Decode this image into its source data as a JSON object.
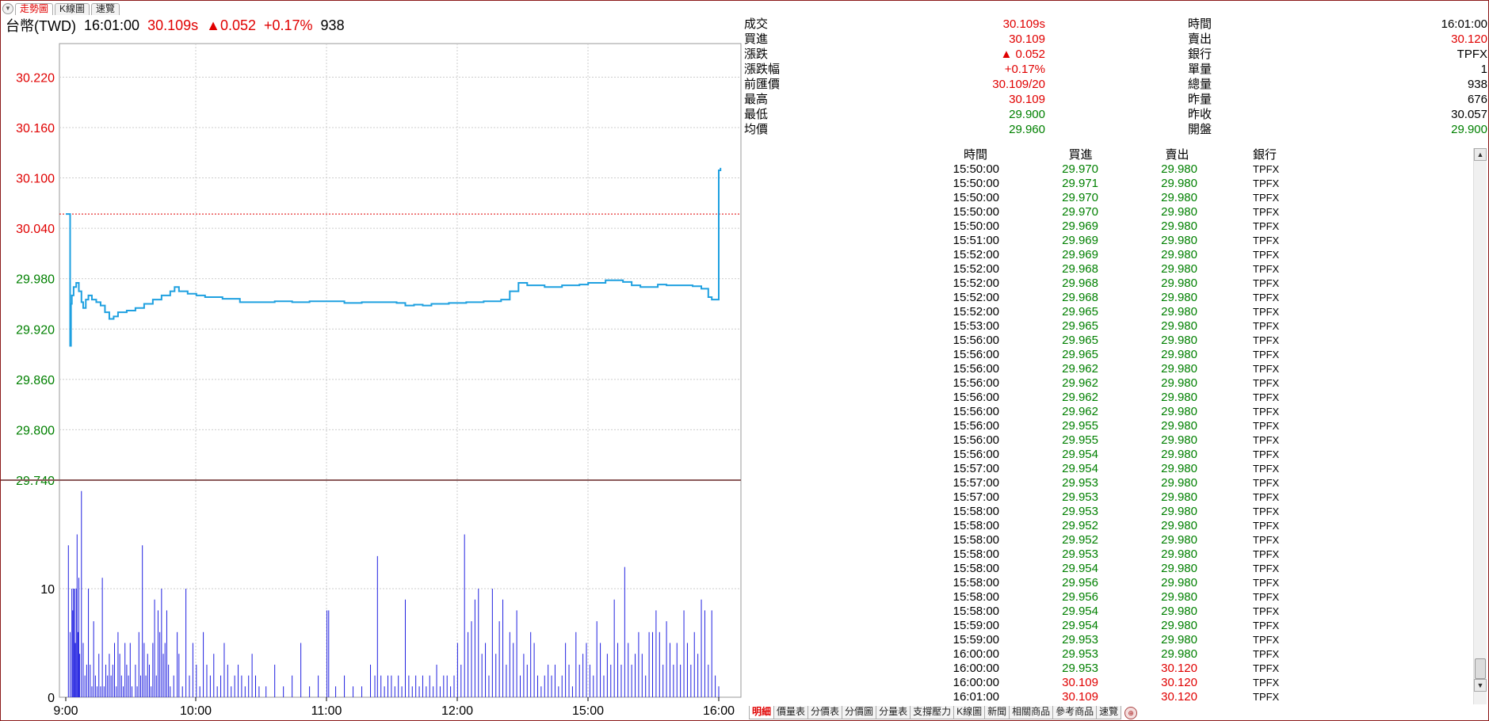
{
  "top_tabs": [
    "走勢圖",
    "K線圖",
    "速覽"
  ],
  "quote": {
    "symbol": "台幣(TWD)",
    "time": "16:01:00",
    "price": "30.109s",
    "change": "▲0.052",
    "change_pct": "+0.17%",
    "volume": "938"
  },
  "info_left": [
    {
      "label": "成交",
      "value": "30.109s",
      "color": "red"
    },
    {
      "label": "買進",
      "value": "30.109",
      "color": "red"
    },
    {
      "label": "漲跌",
      "value": "▲ 0.052",
      "color": "red"
    },
    {
      "label": "漲跌幅",
      "value": "+0.17%",
      "color": "red"
    },
    {
      "label": "前匯價",
      "value": "30.109/20",
      "color": "red"
    },
    {
      "label": "最高",
      "value": "30.109",
      "color": "red"
    },
    {
      "label": "最低",
      "value": "29.900",
      "color": "green"
    },
    {
      "label": "均價",
      "value": "29.960",
      "color": "green"
    }
  ],
  "info_right": [
    {
      "label": "時間",
      "value": "16:01:00",
      "color": "black"
    },
    {
      "label": "賣出",
      "value": "30.120",
      "color": "red"
    },
    {
      "label": "銀行",
      "value": "TPFX",
      "color": "black"
    },
    {
      "label": "單量",
      "value": "1",
      "color": "black"
    },
    {
      "label": "總量",
      "value": "938",
      "color": "black"
    },
    {
      "label": "昨量",
      "value": "676",
      "color": "black"
    },
    {
      "label": "昨收",
      "value": "30.057",
      "color": "black"
    },
    {
      "label": "開盤",
      "value": "29.900",
      "color": "green"
    }
  ],
  "trade_headers": {
    "time": "時間",
    "bid": "買進",
    "ask": "賣出",
    "bank": "銀行"
  },
  "trades": [
    {
      "time": "15:50:00",
      "bid": "29.970",
      "ask": "29.980",
      "bank": "TPFX",
      "up": false
    },
    {
      "time": "15:50:00",
      "bid": "29.971",
      "ask": "29.980",
      "bank": "TPFX",
      "up": false
    },
    {
      "time": "15:50:00",
      "bid": "29.970",
      "ask": "29.980",
      "bank": "TPFX",
      "up": false
    },
    {
      "time": "15:50:00",
      "bid": "29.970",
      "ask": "29.980",
      "bank": "TPFX",
      "up": false
    },
    {
      "time": "15:50:00",
      "bid": "29.969",
      "ask": "29.980",
      "bank": "TPFX",
      "up": false
    },
    {
      "time": "15:51:00",
      "bid": "29.969",
      "ask": "29.980",
      "bank": "TPFX",
      "up": false
    },
    {
      "time": "15:52:00",
      "bid": "29.969",
      "ask": "29.980",
      "bank": "TPFX",
      "up": false
    },
    {
      "time": "15:52:00",
      "bid": "29.968",
      "ask": "29.980",
      "bank": "TPFX",
      "up": false
    },
    {
      "time": "15:52:00",
      "bid": "29.968",
      "ask": "29.980",
      "bank": "TPFX",
      "up": false
    },
    {
      "time": "15:52:00",
      "bid": "29.968",
      "ask": "29.980",
      "bank": "TPFX",
      "up": false
    },
    {
      "time": "15:52:00",
      "bid": "29.965",
      "ask": "29.980",
      "bank": "TPFX",
      "up": false
    },
    {
      "time": "15:53:00",
      "bid": "29.965",
      "ask": "29.980",
      "bank": "TPFX",
      "up": false
    },
    {
      "time": "15:56:00",
      "bid": "29.965",
      "ask": "29.980",
      "bank": "TPFX",
      "up": false
    },
    {
      "time": "15:56:00",
      "bid": "29.965",
      "ask": "29.980",
      "bank": "TPFX",
      "up": false
    },
    {
      "time": "15:56:00",
      "bid": "29.962",
      "ask": "29.980",
      "bank": "TPFX",
      "up": false
    },
    {
      "time": "15:56:00",
      "bid": "29.962",
      "ask": "29.980",
      "bank": "TPFX",
      "up": false
    },
    {
      "time": "15:56:00",
      "bid": "29.962",
      "ask": "29.980",
      "bank": "TPFX",
      "up": false
    },
    {
      "time": "15:56:00",
      "bid": "29.962",
      "ask": "29.980",
      "bank": "TPFX",
      "up": false
    },
    {
      "time": "15:56:00",
      "bid": "29.955",
      "ask": "29.980",
      "bank": "TPFX",
      "up": false
    },
    {
      "time": "15:56:00",
      "bid": "29.955",
      "ask": "29.980",
      "bank": "TPFX",
      "up": false
    },
    {
      "time": "15:56:00",
      "bid": "29.954",
      "ask": "29.980",
      "bank": "TPFX",
      "up": false
    },
    {
      "time": "15:57:00",
      "bid": "29.954",
      "ask": "29.980",
      "bank": "TPFX",
      "up": false
    },
    {
      "time": "15:57:00",
      "bid": "29.953",
      "ask": "29.980",
      "bank": "TPFX",
      "up": false
    },
    {
      "time": "15:57:00",
      "bid": "29.953",
      "ask": "29.980",
      "bank": "TPFX",
      "up": false
    },
    {
      "time": "15:58:00",
      "bid": "29.953",
      "ask": "29.980",
      "bank": "TPFX",
      "up": false
    },
    {
      "time": "15:58:00",
      "bid": "29.952",
      "ask": "29.980",
      "bank": "TPFX",
      "up": false
    },
    {
      "time": "15:58:00",
      "bid": "29.952",
      "ask": "29.980",
      "bank": "TPFX",
      "up": false
    },
    {
      "time": "15:58:00",
      "bid": "29.953",
      "ask": "29.980",
      "bank": "TPFX",
      "up": false
    },
    {
      "time": "15:58:00",
      "bid": "29.954",
      "ask": "29.980",
      "bank": "TPFX",
      "up": false
    },
    {
      "time": "15:58:00",
      "bid": "29.956",
      "ask": "29.980",
      "bank": "TPFX",
      "up": false
    },
    {
      "time": "15:58:00",
      "bid": "29.956",
      "ask": "29.980",
      "bank": "TPFX",
      "up": false
    },
    {
      "time": "15:58:00",
      "bid": "29.954",
      "ask": "29.980",
      "bank": "TPFX",
      "up": false
    },
    {
      "time": "15:59:00",
      "bid": "29.954",
      "ask": "29.980",
      "bank": "TPFX",
      "up": false
    },
    {
      "time": "15:59:00",
      "bid": "29.953",
      "ask": "29.980",
      "bank": "TPFX",
      "up": false
    },
    {
      "time": "16:00:00",
      "bid": "29.953",
      "ask": "29.980",
      "bank": "TPFX",
      "up": false
    },
    {
      "time": "16:00:00",
      "bid": "29.953",
      "ask": "30.120",
      "bank": "TPFX",
      "up": true
    },
    {
      "time": "16:00:00",
      "bid": "30.109",
      "ask": "30.120",
      "bank": "TPFX",
      "up": true
    },
    {
      "time": "16:01:00",
      "bid": "30.109",
      "ask": "30.120",
      "bank": "TPFX",
      "up": true
    }
  ],
  "bottom_tabs": [
    "明細",
    "價量表",
    "分價表",
    "分價圖",
    "分量表",
    "支撐壓力",
    "K線圖",
    "新聞",
    "相關商品",
    "參考商品",
    "速覽"
  ],
  "colors": {
    "up": "#e00000",
    "down": "#008000",
    "line": "#1ea0e0",
    "volume": "#2020e0",
    "ref": "#e00000"
  },
  "chart_data": {
    "type": "line",
    "x_ticks": [
      "9:00",
      "10:00",
      "11:00",
      "12:00",
      "15:00",
      "16:00"
    ],
    "price_ticks": [
      "30.220",
      "30.160",
      "30.100",
      "30.040",
      "29.980",
      "29.920",
      "29.860",
      "29.800",
      "29.740"
    ],
    "price_tick_colors": [
      "red",
      "red",
      "red",
      "red",
      "green",
      "green",
      "green",
      "green",
      "green"
    ],
    "volume_ticks": [
      "10",
      "0"
    ],
    "ylim": [
      29.74,
      30.26
    ],
    "reference_price": 30.057,
    "volume_max": 20,
    "price_series": [
      [
        0.0,
        30.057
      ],
      [
        0.04,
        30.057
      ],
      [
        0.05,
        29.9
      ],
      [
        0.06,
        29.95
      ],
      [
        0.07,
        29.96
      ],
      [
        0.09,
        29.97
      ],
      [
        0.12,
        29.975
      ],
      [
        0.15,
        29.965
      ],
      [
        0.18,
        29.952
      ],
      [
        0.2,
        29.945
      ],
      [
        0.23,
        29.955
      ],
      [
        0.26,
        29.96
      ],
      [
        0.3,
        29.955
      ],
      [
        0.35,
        29.952
      ],
      [
        0.4,
        29.948
      ],
      [
        0.45,
        29.94
      ],
      [
        0.5,
        29.932
      ],
      [
        0.55,
        29.935
      ],
      [
        0.6,
        29.94
      ],
      [
        0.7,
        29.942
      ],
      [
        0.8,
        29.945
      ],
      [
        0.9,
        29.95
      ],
      [
        1.0,
        29.955
      ],
      [
        1.1,
        29.96
      ],
      [
        1.2,
        29.965
      ],
      [
        1.25,
        29.97
      ],
      [
        1.3,
        29.965
      ],
      [
        1.4,
        29.962
      ],
      [
        1.5,
        29.96
      ],
      [
        1.6,
        29.958
      ],
      [
        1.8,
        29.956
      ],
      [
        2.0,
        29.952
      ],
      [
        2.2,
        29.952
      ],
      [
        2.4,
        29.953
      ],
      [
        2.6,
        29.952
      ],
      [
        2.8,
        29.953
      ],
      [
        3.0,
        29.953
      ],
      [
        3.2,
        29.951
      ],
      [
        3.4,
        29.952
      ],
      [
        3.6,
        29.952
      ],
      [
        3.8,
        29.951
      ],
      [
        3.9,
        29.948
      ],
      [
        4.0,
        29.949
      ],
      [
        4.1,
        29.948
      ],
      [
        4.2,
        29.95
      ],
      [
        4.4,
        29.951
      ],
      [
        4.6,
        29.952
      ],
      [
        4.8,
        29.953
      ],
      [
        5.0,
        29.955
      ],
      [
        5.1,
        29.965
      ],
      [
        5.2,
        29.975
      ],
      [
        5.3,
        29.972
      ],
      [
        5.5,
        29.97
      ],
      [
        5.7,
        29.972
      ],
      [
        5.9,
        29.973
      ],
      [
        6.0,
        29.975
      ],
      [
        6.2,
        29.978
      ],
      [
        6.4,
        29.976
      ],
      [
        6.5,
        29.972
      ],
      [
        6.6,
        29.97
      ],
      [
        6.8,
        29.973
      ],
      [
        6.9,
        29.972
      ],
      [
        7.0,
        29.972
      ],
      [
        7.2,
        29.971
      ],
      [
        7.3,
        29.968
      ],
      [
        7.38,
        29.958
      ],
      [
        7.42,
        29.955
      ],
      [
        7.48,
        29.955
      ],
      [
        7.5,
        30.109
      ],
      [
        7.52,
        30.112
      ]
    ],
    "volume_series": [
      [
        0.03,
        14
      ],
      [
        0.05,
        6
      ],
      [
        0.07,
        10
      ],
      [
        0.08,
        8
      ],
      [
        0.09,
        10
      ],
      [
        0.1,
        10
      ],
      [
        0.11,
        5
      ],
      [
        0.12,
        10
      ],
      [
        0.13,
        15
      ],
      [
        0.14,
        6
      ],
      [
        0.15,
        11
      ],
      [
        0.16,
        4
      ],
      [
        0.18,
        19
      ],
      [
        0.2,
        5
      ],
      [
        0.22,
        2
      ],
      [
        0.24,
        3
      ],
      [
        0.26,
        10
      ],
      [
        0.28,
        3
      ],
      [
        0.3,
        1
      ],
      [
        0.32,
        7
      ],
      [
        0.34,
        2
      ],
      [
        0.36,
        1
      ],
      [
        0.38,
        4
      ],
      [
        0.4,
        1
      ],
      [
        0.42,
        11
      ],
      [
        0.44,
        1
      ],
      [
        0.46,
        3
      ],
      [
        0.48,
        2
      ],
      [
        0.5,
        4
      ],
      [
        0.52,
        2
      ],
      [
        0.54,
        3
      ],
      [
        0.56,
        5
      ],
      [
        0.58,
        1
      ],
      [
        0.6,
        6
      ],
      [
        0.62,
        4
      ],
      [
        0.64,
        2
      ],
      [
        0.66,
        1
      ],
      [
        0.68,
        5
      ],
      [
        0.7,
        3
      ],
      [
        0.72,
        2
      ],
      [
        0.74,
        5
      ],
      [
        0.76,
        1
      ],
      [
        0.8,
        3
      ],
      [
        0.82,
        1
      ],
      [
        0.84,
        6
      ],
      [
        0.86,
        2
      ],
      [
        0.88,
        14
      ],
      [
        0.9,
        5
      ],
      [
        0.92,
        2
      ],
      [
        0.94,
        4
      ],
      [
        0.96,
        3
      ],
      [
        0.98,
        1
      ],
      [
        1.0,
        5
      ],
      [
        1.02,
        9
      ],
      [
        1.04,
        2
      ],
      [
        1.06,
        8
      ],
      [
        1.08,
        6
      ],
      [
        1.1,
        10
      ],
      [
        1.12,
        4
      ],
      [
        1.14,
        5
      ],
      [
        1.16,
        8
      ],
      [
        1.18,
        3
      ],
      [
        1.2,
        1
      ],
      [
        1.24,
        2
      ],
      [
        1.28,
        6
      ],
      [
        1.3,
        4
      ],
      [
        1.34,
        1
      ],
      [
        1.38,
        10
      ],
      [
        1.42,
        2
      ],
      [
        1.46,
        5
      ],
      [
        1.5,
        3
      ],
      [
        1.54,
        1
      ],
      [
        1.58,
        6
      ],
      [
        1.62,
        3
      ],
      [
        1.66,
        2
      ],
      [
        1.7,
        4
      ],
      [
        1.74,
        1
      ],
      [
        1.78,
        2
      ],
      [
        1.82,
        5
      ],
      [
        1.86,
        3
      ],
      [
        1.9,
        1
      ],
      [
        1.94,
        2
      ],
      [
        1.98,
        3
      ],
      [
        2.02,
        2
      ],
      [
        2.06,
        1
      ],
      [
        2.1,
        2
      ],
      [
        2.14,
        4
      ],
      [
        2.18,
        2
      ],
      [
        2.22,
        1
      ],
      [
        2.3,
        1
      ],
      [
        2.4,
        3
      ],
      [
        2.5,
        1
      ],
      [
        2.6,
        2
      ],
      [
        2.7,
        5
      ],
      [
        2.8,
        1
      ],
      [
        2.9,
        2
      ],
      [
        3.0,
        8
      ],
      [
        3.02,
        8
      ],
      [
        3.1,
        1
      ],
      [
        3.2,
        2
      ],
      [
        3.3,
        1
      ],
      [
        3.4,
        1
      ],
      [
        3.5,
        3
      ],
      [
        3.55,
        2
      ],
      [
        3.58,
        13
      ],
      [
        3.62,
        2
      ],
      [
        3.66,
        1
      ],
      [
        3.7,
        2
      ],
      [
        3.74,
        2
      ],
      [
        3.78,
        1
      ],
      [
        3.82,
        2
      ],
      [
        3.86,
        1
      ],
      [
        3.9,
        9
      ],
      [
        3.94,
        2
      ],
      [
        3.98,
        1
      ],
      [
        4.02,
        2
      ],
      [
        4.06,
        1
      ],
      [
        4.1,
        2
      ],
      [
        4.14,
        1
      ],
      [
        4.18,
        2
      ],
      [
        4.22,
        1
      ],
      [
        4.26,
        3
      ],
      [
        4.3,
        1
      ],
      [
        4.34,
        2
      ],
      [
        4.38,
        2
      ],
      [
        4.42,
        1
      ],
      [
        4.46,
        2
      ],
      [
        4.5,
        5
      ],
      [
        4.54,
        3
      ],
      [
        4.58,
        15
      ],
      [
        4.62,
        6
      ],
      [
        4.66,
        7
      ],
      [
        4.7,
        9
      ],
      [
        4.74,
        10
      ],
      [
        4.78,
        4
      ],
      [
        4.82,
        5
      ],
      [
        4.86,
        2
      ],
      [
        4.9,
        10
      ],
      [
        4.94,
        4
      ],
      [
        4.98,
        7
      ],
      [
        5.02,
        9
      ],
      [
        5.06,
        3
      ],
      [
        5.1,
        6
      ],
      [
        5.14,
        5
      ],
      [
        5.18,
        8
      ],
      [
        5.22,
        2
      ],
      [
        5.26,
        4
      ],
      [
        5.3,
        3
      ],
      [
        5.34,
        6
      ],
      [
        5.38,
        5
      ],
      [
        5.42,
        2
      ],
      [
        5.46,
        1
      ],
      [
        5.5,
        2
      ],
      [
        5.54,
        3
      ],
      [
        5.58,
        2
      ],
      [
        5.62,
        3
      ],
      [
        5.66,
        1
      ],
      [
        5.7,
        2
      ],
      [
        5.74,
        5
      ],
      [
        5.78,
        3
      ],
      [
        5.82,
        1
      ],
      [
        5.86,
        6
      ],
      [
        5.9,
        3
      ],
      [
        5.94,
        4
      ],
      [
        5.98,
        5
      ],
      [
        6.02,
        3
      ],
      [
        6.06,
        2
      ],
      [
        6.1,
        7
      ],
      [
        6.14,
        5
      ],
      [
        6.18,
        2
      ],
      [
        6.22,
        4
      ],
      [
        6.26,
        3
      ],
      [
        6.3,
        9
      ],
      [
        6.34,
        5
      ],
      [
        6.38,
        3
      ],
      [
        6.42,
        12
      ],
      [
        6.46,
        5
      ],
      [
        6.5,
        3
      ],
      [
        6.54,
        4
      ],
      [
        6.58,
        6
      ],
      [
        6.62,
        4
      ],
      [
        6.66,
        2
      ],
      [
        6.7,
        6
      ],
      [
        6.74,
        6
      ],
      [
        6.78,
        8
      ],
      [
        6.82,
        6
      ],
      [
        6.86,
        3
      ],
      [
        6.9,
        7
      ],
      [
        6.94,
        5
      ],
      [
        6.98,
        3
      ],
      [
        7.02,
        5
      ],
      [
        7.06,
        3
      ],
      [
        7.1,
        8
      ],
      [
        7.14,
        5
      ],
      [
        7.18,
        3
      ],
      [
        7.22,
        6
      ],
      [
        7.26,
        4
      ],
      [
        7.3,
        9
      ],
      [
        7.34,
        8
      ],
      [
        7.38,
        3
      ],
      [
        7.42,
        8
      ],
      [
        7.46,
        2
      ],
      [
        7.5,
        1
      ]
    ]
  }
}
